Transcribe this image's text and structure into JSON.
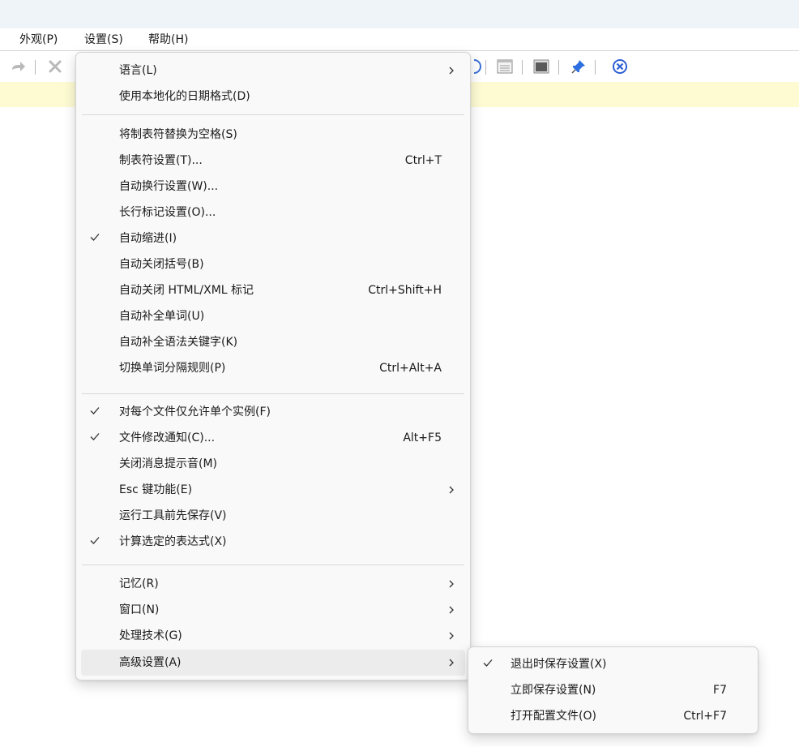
{
  "menubar": [
    {
      "label": "外观(P)"
    },
    {
      "label": "设置(S)"
    },
    {
      "label": "帮助(H)"
    }
  ],
  "settings_menu": {
    "groups": [
      [
        {
          "label": "语言(L)",
          "submenu": true
        },
        {
          "label": "使用本地化的日期格式(D)"
        }
      ],
      [
        {
          "label": "将制表符替换为空格(S)"
        },
        {
          "label": "制表符设置(T)...",
          "shortcut": "Ctrl+T"
        },
        {
          "label": "自动换行设置(W)..."
        },
        {
          "label": "长行标记设置(O)..."
        },
        {
          "label": "自动缩进(I)",
          "checked": true
        },
        {
          "label": "自动关闭括号(B)"
        },
        {
          "label": "自动关闭 HTML/XML 标记",
          "shortcut": "Ctrl+Shift+H"
        },
        {
          "label": "自动补全单词(U)"
        },
        {
          "label": "自动补全语法关键字(K)"
        },
        {
          "label": "切换单词分隔规则(P)",
          "shortcut": "Ctrl+Alt+A"
        }
      ],
      [
        {
          "label": "对每个文件仅允许单个实例(F)",
          "checked": true
        },
        {
          "label": "文件修改通知(C)...",
          "shortcut": "Alt+F5",
          "checked": true
        },
        {
          "label": "关闭消息提示音(M)"
        },
        {
          "label": "Esc 键功能(E)",
          "submenu": true
        },
        {
          "label": "运行工具前先保存(V)"
        },
        {
          "label": "计算选定的表达式(X)",
          "checked": true
        }
      ],
      [
        {
          "label": "记忆(R)",
          "submenu": true
        },
        {
          "label": "窗口(N)",
          "submenu": true
        },
        {
          "label": "处理技术(G)",
          "submenu": true
        },
        {
          "label": "高级设置(A)",
          "submenu": true,
          "highlighted": true
        }
      ]
    ]
  },
  "advanced_submenu": [
    {
      "label": "退出时保存设置(X)",
      "checked": true
    },
    {
      "label": "立即保存设置(N)",
      "shortcut": "F7"
    },
    {
      "label": "打开配置文件(O)",
      "shortcut": "Ctrl+F7"
    }
  ],
  "icons": {
    "toolbar_left": [
      "redo-arrow-icon",
      "cut-scissors-icon"
    ],
    "toolbar_right": [
      "help-circle-icon",
      "list-view-icon",
      "terminal-icon",
      "pin-icon",
      "close-circle-icon"
    ]
  },
  "colors": {
    "info_bar": "#fefbd3",
    "title_bar": "#eff4f9",
    "menu_bg": "#f9f9f9",
    "highlight": "#ececec",
    "accent_blue": "#2d5fd3"
  }
}
